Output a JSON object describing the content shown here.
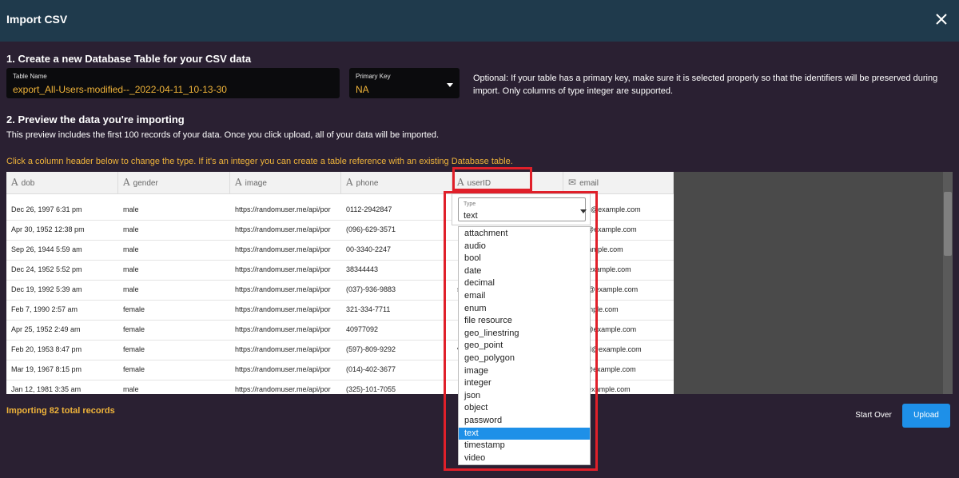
{
  "dialog": {
    "title": "Import CSV"
  },
  "section1": {
    "heading": "1. Create a new Database Table for your CSV data",
    "table_name": {
      "label": "Table Name",
      "value": "export_All-Users-modified--_2022-04-11_10-13-30"
    },
    "primary_key": {
      "label": "Primary Key",
      "value": "NA"
    },
    "optional_note": "Optional: If your table has a primary key, make sure it is selected properly so that the identifiers will be preserved during import. Only columns of type integer are supported."
  },
  "section2": {
    "heading": "2. Preview the data you're importing",
    "description": "This preview includes the first 100 records of your data. Once you click upload, all of your data will be imported.",
    "hint": "Click a column header below to change the type. If it's an integer you can create a table reference with an existing Database table."
  },
  "table": {
    "columns": [
      {
        "icon": "A",
        "label": "dob"
      },
      {
        "icon": "A",
        "label": "gender"
      },
      {
        "icon": "A",
        "label": "image"
      },
      {
        "icon": "A",
        "label": "phone"
      },
      {
        "icon": "A",
        "label": "userID"
      },
      {
        "icon": "✉",
        "label": "email"
      }
    ],
    "rows": [
      [
        "Dec 26, 1997 6:31 pm",
        "male",
        "https://randomuser.me/api/por",
        "0112-2942847",
        "",
        "einicke@example.com"
      ],
      [
        "Apr 30, 1952 12:38 pm",
        "male",
        "https://randomuser.me/api/por",
        "(096)-629-3571",
        "",
        "green@example.com"
      ],
      [
        "Sep 26, 1944 5:59 am",
        "male",
        "https://randomuser.me/api/por",
        "00-3340-2247",
        "",
        "ill@example.com"
      ],
      [
        "Dec 24, 1952 5:52 pm",
        "male",
        "https://randomuser.me/api/por",
        "38344443",
        "",
        "ckle@example.com"
      ],
      [
        "Dec 19, 1992 5:39 am",
        "male",
        "https://randomuser.me/api/por",
        "(037)-936-9883",
        "s",
        "zhang@example.com"
      ],
      [
        "Feb 7, 1990 2:57 am",
        "female",
        "https://randomuser.me/api/por",
        "321-334-7711",
        "",
        "@example.com"
      ],
      [
        "Apr 25, 1952 2:49 am",
        "female",
        "https://randomuser.me/api/por",
        "40977092",
        "",
        "ersen@example.com"
      ],
      [
        "Feb 20, 1953 8:47 pm",
        "female",
        "https://randomuser.me/api/por",
        "(597)-809-9292",
        "v",
        ".denkel@example.com"
      ],
      [
        "Mar 19, 1967 8:15 pm",
        "female",
        "https://randomuser.me/api/por",
        "(014)-402-3677",
        "",
        "rcetin@example.com"
      ],
      [
        "Jan 12, 1981 3:35 am",
        "male",
        "https://randomuser.me/api/por",
        "(325)-101-7055",
        "",
        "ben@example.com"
      ]
    ]
  },
  "type_picker": {
    "label": "Type",
    "value": "text",
    "options": [
      "attachment",
      "audio",
      "bool",
      "date",
      "decimal",
      "email",
      "enum",
      "file resource",
      "geo_linestring",
      "geo_point",
      "geo_polygon",
      "image",
      "integer",
      "json",
      "object",
      "password",
      "text",
      "timestamp",
      "video"
    ],
    "selected": "text"
  },
  "footer": {
    "count_text": "Importing 82 total records",
    "start_over": "Start Over",
    "upload": "Upload"
  },
  "colors": {
    "titlebar": "#1f3a4c",
    "background": "#2a2032",
    "accent": "#f0b43a",
    "primary_button": "#1e90e8",
    "highlight_box": "#e0202a"
  }
}
